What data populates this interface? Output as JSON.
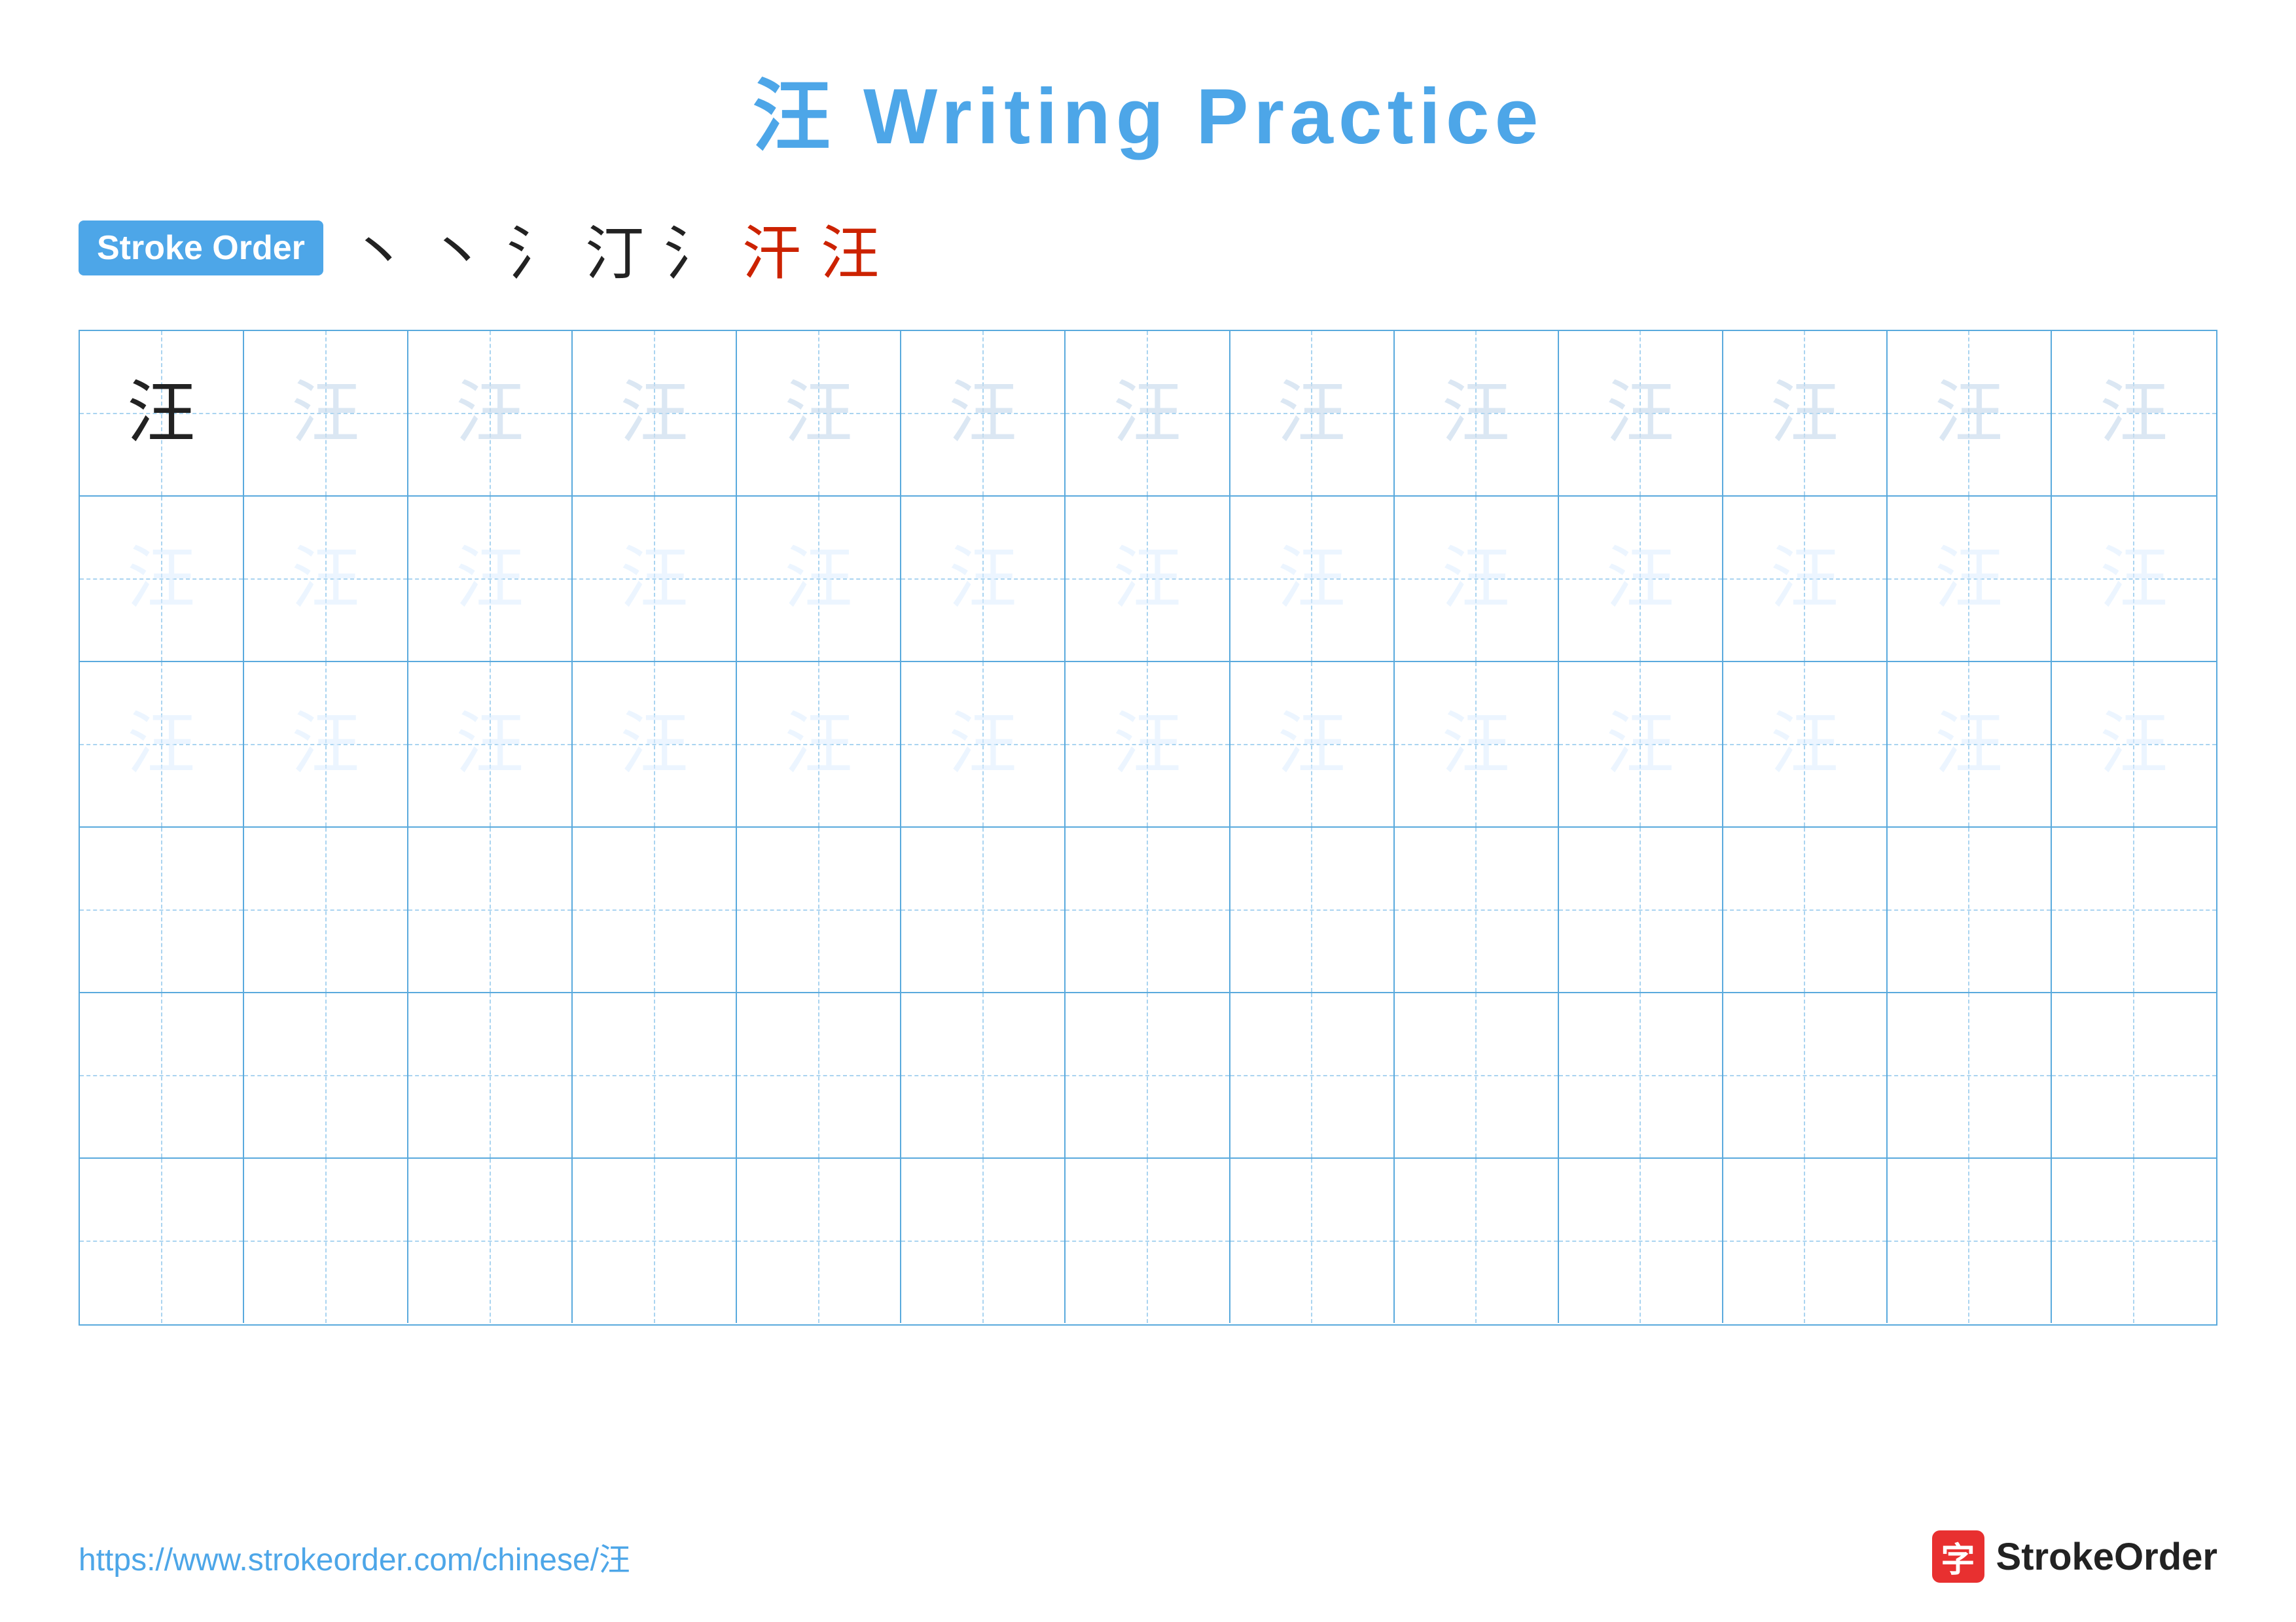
{
  "title": "汪 Writing Practice",
  "stroke_order": {
    "badge_label": "Stroke Order",
    "strokes": [
      "丶",
      "丶",
      "氵",
      "汀",
      "氵",
      "汗",
      "汪"
    ]
  },
  "character": "汪",
  "grid": {
    "rows": 6,
    "cols": 13
  },
  "footer": {
    "url": "https://www.strokeorder.com/chinese/汪",
    "logo_text": "StrokeOrder",
    "logo_icon": "字"
  }
}
